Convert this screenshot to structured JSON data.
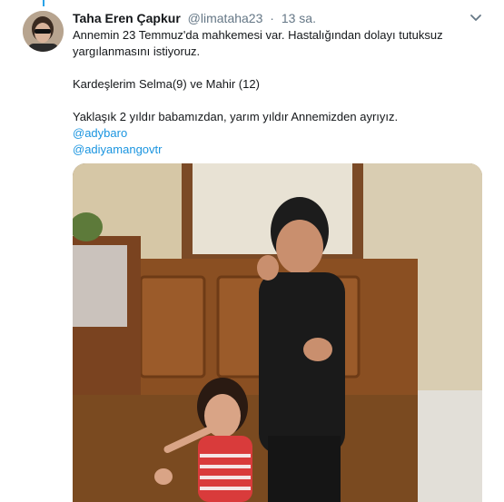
{
  "tweet": {
    "author_name": "Taha Eren Çapkur",
    "handle": "@limataha23",
    "separator": "·",
    "time": "13 sa.",
    "lines": [
      "Annemin 23 Temmuz'da mahkemesi var. Hastalığından dolayı tutuksuz yargılanmasını istiyoruz.",
      "Kardeşlerim Selma(9) ve Mahir (12)",
      "Yaklaşık 2 yıldır babamızdan, yarım yıldır Annemizden  ayrıyız."
    ],
    "mentions": [
      "@adybaro",
      "@adiyamangovtr"
    ]
  },
  "icons": {
    "more": "chevron-down-icon"
  },
  "colors": {
    "link": "#1b95e0",
    "thread_line": "#2aa3e8",
    "muted": "#657786"
  }
}
